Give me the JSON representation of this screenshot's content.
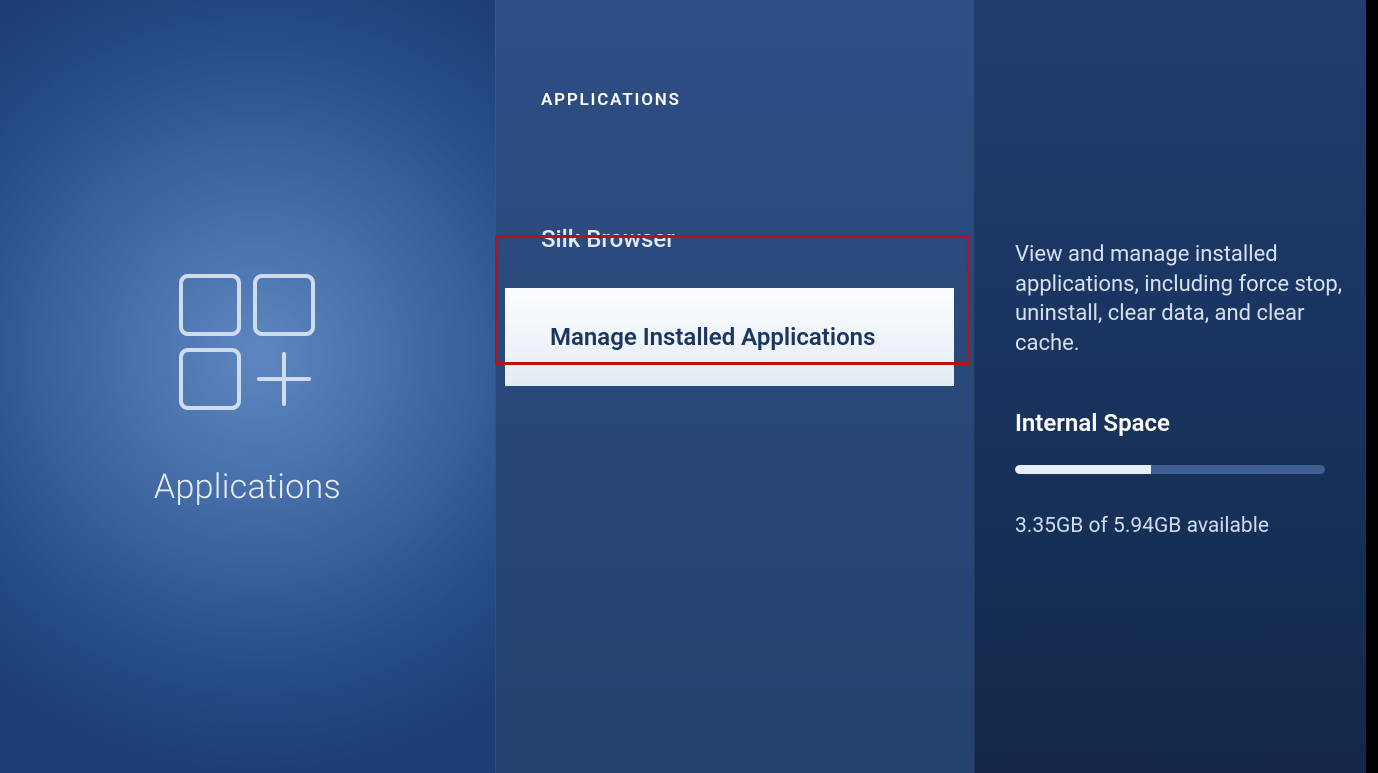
{
  "left_panel": {
    "label": "Applications"
  },
  "middle_panel": {
    "header": "APPLICATIONS",
    "items": [
      {
        "label": "Silk Browser",
        "selected": false
      },
      {
        "label": "Manage Installed Applications",
        "selected": true
      }
    ]
  },
  "right_panel": {
    "description": "View and manage installed applications, including force stop, uninstall, clear data, and clear cache.",
    "storage": {
      "title": "Internal Space",
      "used_gb": 3.35,
      "total_gb": 5.94,
      "fill_percent": 44,
      "summary": "3.35GB of 5.94GB available"
    }
  }
}
